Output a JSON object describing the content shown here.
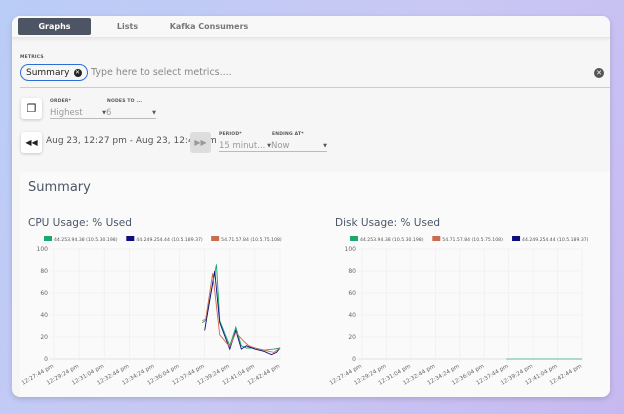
{
  "tabs": [
    {
      "label": "Graphs",
      "active": true
    },
    {
      "label": "Lists"
    },
    {
      "label": "Kafka Consumers"
    }
  ],
  "metrics": {
    "label": "METRICS",
    "chip": "Summary",
    "placeholder": "Type here to select metrics...."
  },
  "order": {
    "label": "ORDER*",
    "value": "Highest"
  },
  "nodes": {
    "label": "NODES TO ...",
    "value": "6"
  },
  "range": "Aug 23, 12:27 pm - Aug 23, 12:42 pm",
  "period": {
    "label": "PERIOD*",
    "value": "15 minut..."
  },
  "ending": {
    "label": "ENDING AT*",
    "value": "Now"
  },
  "section_title": "Summary",
  "chart_data": [
    {
      "type": "line",
      "title": "CPU Usage: % Used",
      "ylim": [
        0,
        100
      ],
      "yticks": [
        0,
        20,
        40,
        60,
        80,
        100
      ],
      "grid": true,
      "legend": "top",
      "xticks": [
        "12:27:44 pm",
        "12:29:24 pm",
        "12:31:04 pm",
        "12:32:44 pm",
        "12:34:24 pm",
        "12:36:04 pm",
        "12:37:44 pm",
        "12:39:24 pm",
        "12:41:04 pm",
        "12:42:44 pm"
      ],
      "series": [
        {
          "name": "44.253.94.38 (10.5.30.198)",
          "color": "#1aa86b",
          "points": [
            [
              "12:37:34",
              33
            ],
            [
              "12:37:48",
              35
            ],
            [
              "12:38:31",
              86
            ],
            [
              "12:38:44",
              35
            ],
            [
              "12:39:24",
              12
            ],
            [
              "12:39:48",
              29
            ],
            [
              "12:40:10",
              12
            ],
            [
              "12:40:30",
              10
            ],
            [
              "12:41:04",
              10
            ],
            [
              "12:41:40",
              8
            ],
            [
              "12:42:20",
              9
            ],
            [
              "12:42:44",
              10
            ]
          ]
        },
        {
          "name": "44.249.254.44 (10.5.189.37)",
          "color": "#0d0d80",
          "points": [
            [
              "12:37:44",
              26
            ],
            [
              "12:38:24",
              80
            ],
            [
              "12:38:44",
              33
            ],
            [
              "12:39:24",
              9
            ],
            [
              "12:39:48",
              26
            ],
            [
              "12:40:10",
              9
            ],
            [
              "12:40:30",
              12
            ],
            [
              "12:41:04",
              9
            ],
            [
              "12:41:40",
              7
            ],
            [
              "12:42:10",
              4
            ],
            [
              "12:42:30",
              6
            ],
            [
              "12:42:44",
              10
            ]
          ]
        },
        {
          "name": "54.71.57.84 (10.5.75.108)",
          "color": "#cc6b4f",
          "points": [
            [
              "12:37:34",
              35
            ],
            [
              "12:37:48",
              36
            ],
            [
              "12:38:16",
              78
            ],
            [
              "12:38:44",
              22
            ],
            [
              "12:39:24",
              11
            ],
            [
              "12:39:48",
              24
            ],
            [
              "12:40:20",
              16
            ],
            [
              "12:40:40",
              12
            ],
            [
              "12:41:04",
              10
            ],
            [
              "12:41:40",
              8
            ],
            [
              "12:42:20",
              6
            ],
            [
              "12:42:44",
              10
            ]
          ]
        }
      ]
    },
    {
      "type": "line",
      "title": "Disk Usage: % Used",
      "ylim": [
        0,
        100
      ],
      "yticks": [
        0,
        20,
        40,
        60,
        80,
        100
      ],
      "grid": true,
      "legend": "top",
      "xticks": [
        "12:27:44 pm",
        "12:29:24 pm",
        "12:31:04 pm",
        "12:32:44 pm",
        "12:34:24 pm",
        "12:36:04 pm",
        "12:37:44 pm",
        "12:39:24 pm",
        "12:41:04 pm",
        "12:42:44 pm"
      ],
      "series": [
        {
          "name": "44.253.94.38 (10.5.30.198)",
          "color": "#1aa86b",
          "points": [
            [
              "12:37:34",
              0
            ],
            [
              "12:42:44",
              0
            ]
          ]
        },
        {
          "name": "54.71.57.84 (10.5.75.108)",
          "color": "#cc6b4f",
          "points": []
        },
        {
          "name": "44.249.254.44 (10.5.189.37)",
          "color": "#0d0d80",
          "points": []
        }
      ]
    }
  ]
}
